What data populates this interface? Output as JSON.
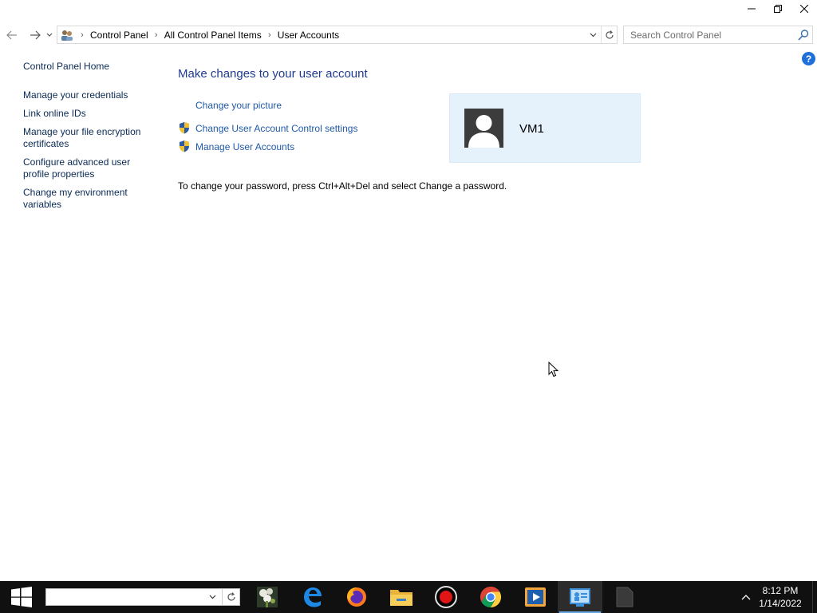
{
  "window": {
    "controls": {
      "minimize": "minimize",
      "restore": "restore",
      "close": "close"
    }
  },
  "address_bar": {
    "breadcrumbs": [
      "Control Panel",
      "All Control Panel Items",
      "User Accounts"
    ],
    "search_placeholder": "Search Control Panel"
  },
  "help": {
    "label": "?"
  },
  "left_pane": {
    "home": "Control Panel Home",
    "tasks": [
      "Manage your credentials",
      "Link online IDs",
      "Manage your file encryption certificates",
      "Configure advanced user profile properties",
      "Change my environment variables"
    ]
  },
  "main": {
    "title": "Make changes to your user account",
    "links": {
      "change_picture": "Change your picture",
      "uac_settings": "Change User Account Control settings",
      "manage_accounts": "Manage User Accounts"
    },
    "password_note": "To change your password, press Ctrl+Alt+Del and select Change a password.",
    "user": {
      "name": "VM1"
    }
  },
  "taskbar": {
    "search_value": "",
    "apps": [
      {
        "name": "photo-app-icon",
        "active": false
      },
      {
        "name": "edge-icon",
        "active": false
      },
      {
        "name": "firefox-icon",
        "active": false
      },
      {
        "name": "file-explorer-icon",
        "active": false
      },
      {
        "name": "record-icon",
        "active": false
      },
      {
        "name": "chrome-icon",
        "active": false
      },
      {
        "name": "media-player-icon",
        "active": false
      },
      {
        "name": "control-panel-icon",
        "active": true
      },
      {
        "name": "blank-app-icon",
        "active": false
      }
    ],
    "clock": {
      "time": "8:12 PM",
      "date": "1/14/2022"
    }
  },
  "colors": {
    "link": "#1f5aa8",
    "title": "#1f3a93",
    "tile_bg": "#e5f1fb",
    "taskbar": "#101010",
    "help": "#1e6fd9"
  }
}
